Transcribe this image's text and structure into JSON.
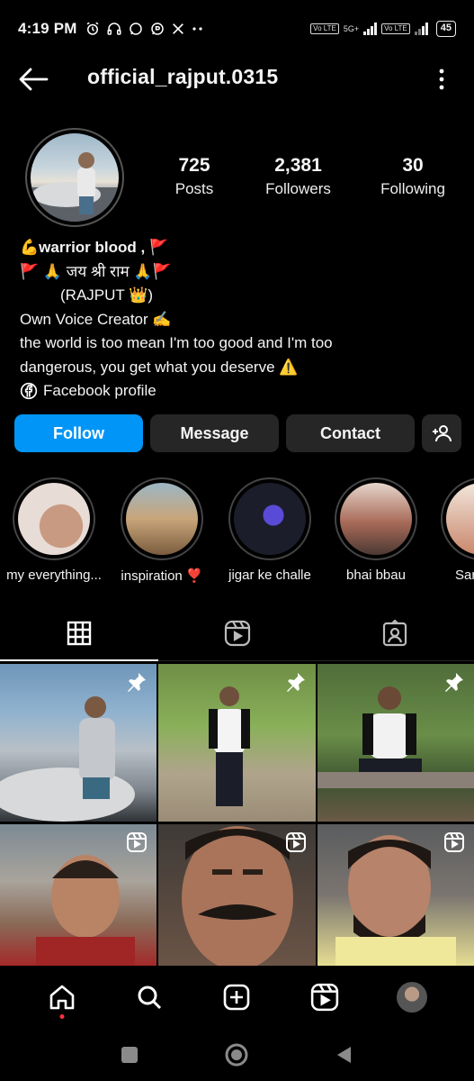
{
  "status_bar": {
    "time": "4:19 PM",
    "left_icons": [
      "alarm-icon",
      "headphones-icon",
      "whatsapp-icon",
      "whatsapp-business-icon",
      "x-icon",
      "more-dots-icon"
    ],
    "sim1_label": "Vo LTE",
    "network": "5G+",
    "sim2_label": "Vo LTE",
    "battery": "45"
  },
  "top_bar": {
    "username": "official_rajput.0315"
  },
  "profile": {
    "stats": [
      {
        "value": "725",
        "label": "Posts"
      },
      {
        "value": "2,381",
        "label": "Followers"
      },
      {
        "value": "30",
        "label": "Following"
      }
    ],
    "bio": {
      "line1": "💪warrior blood , 🚩",
      "line2": "🚩 🙏 जय श्री राम 🙏🚩",
      "line3": "(RAJPUT 👑)",
      "line4": "Own Voice Creator ✍️",
      "line5": "the world is too mean  I'm too good and I'm too",
      "line6": "dangerous, you get what you deserve ⚠️",
      "link": "Facebook profile"
    }
  },
  "buttons": {
    "follow": "Follow",
    "message": "Message",
    "contact": "Contact"
  },
  "highlights": [
    {
      "label": "my everything..."
    },
    {
      "label": "inspiration ❣️"
    },
    {
      "label": "jigar ke challe"
    },
    {
      "label": "bhai bbau"
    },
    {
      "label": "Sar"
    }
  ],
  "tabs": [
    "grid-icon",
    "reels-icon",
    "tagged-icon"
  ],
  "posts": [
    {
      "type": "pinned"
    },
    {
      "type": "pinned"
    },
    {
      "type": "pinned"
    },
    {
      "type": "reel"
    },
    {
      "type": "reel"
    },
    {
      "type": "reel"
    }
  ],
  "bottom_nav": [
    "home-icon",
    "search-icon",
    "create-icon",
    "reels-icon",
    "profile-avatar"
  ],
  "colors": {
    "background": "#000000",
    "follow_button": "#0095f6",
    "secondary_button": "#262626",
    "notification_dot": "#ff3040"
  }
}
